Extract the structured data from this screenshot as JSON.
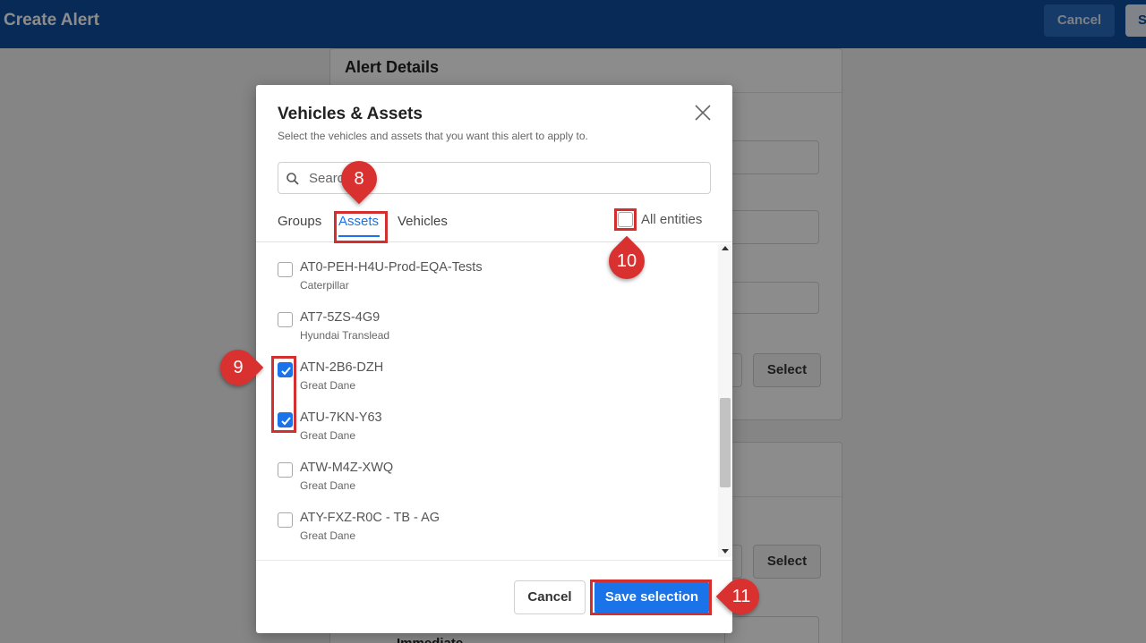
{
  "topbar": {
    "title": "Create Alert",
    "cancel_label": "Cancel",
    "save_label": "S"
  },
  "background": {
    "card_title": "Alert Details",
    "select_label": "Select",
    "select_label_2": "Select",
    "partial_text": "Immediate"
  },
  "modal": {
    "title": "Vehicles & Assets",
    "subtitle": "Select the vehicles and assets that you want this alert to apply to.",
    "search_placeholder": "Search",
    "tabs": [
      {
        "label": "Groups",
        "active": false
      },
      {
        "label": "Assets",
        "active": true
      },
      {
        "label": "Vehicles",
        "active": false
      }
    ],
    "all_entities_label": "All entities",
    "all_entities_checked": false,
    "items": [
      {
        "name": "AT0-PEH-H4U-Prod-EQA-Tests",
        "maker": "Caterpillar",
        "checked": false
      },
      {
        "name": "AT7-5ZS-4G9",
        "maker": "Hyundai Translead",
        "checked": false
      },
      {
        "name": "ATN-2B6-DZH",
        "maker": "Great Dane",
        "checked": true
      },
      {
        "name": "ATU-7KN-Y63",
        "maker": "Great Dane",
        "checked": true
      },
      {
        "name": "ATW-M4Z-XWQ",
        "maker": "Great Dane",
        "checked": false
      },
      {
        "name": "ATY-FXZ-R0C - TB - AG",
        "maker": "Great Dane",
        "checked": false
      }
    ],
    "cancel_label": "Cancel",
    "save_label": "Save selection"
  },
  "annotations": {
    "step8": "8",
    "step9": "9",
    "step10": "10",
    "step11": "11"
  },
  "colors": {
    "topbar": "#0d4d9e",
    "accent": "#1a73e8",
    "callout": "#d32f2f"
  }
}
